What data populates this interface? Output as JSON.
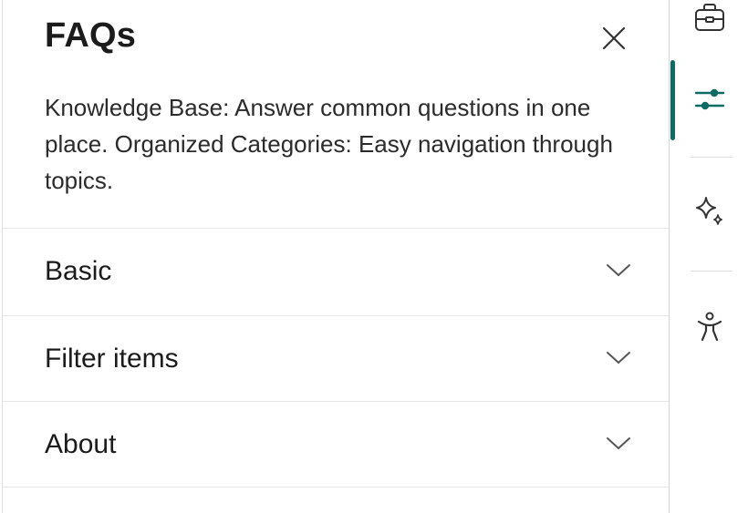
{
  "panel": {
    "title": "FAQs",
    "close_icon": "close-icon",
    "description": "Knowledge Base: Answer common questions in one place. Organized Categories: Easy navigation through topics."
  },
  "accordion": [
    {
      "label": "Basic",
      "icon": "chevron-down-icon"
    },
    {
      "label": "Filter items",
      "icon": "chevron-down-icon"
    },
    {
      "label": "About",
      "icon": "chevron-down-icon"
    }
  ],
  "rail": {
    "accent_color": "#0f6b63",
    "items": [
      {
        "icon": "briefcase-icon",
        "active": false
      },
      {
        "icon": "sliders-icon",
        "active": true
      },
      {
        "icon": "sparkle-icon",
        "active": false
      },
      {
        "icon": "accessibility-icon",
        "active": false
      }
    ]
  }
}
